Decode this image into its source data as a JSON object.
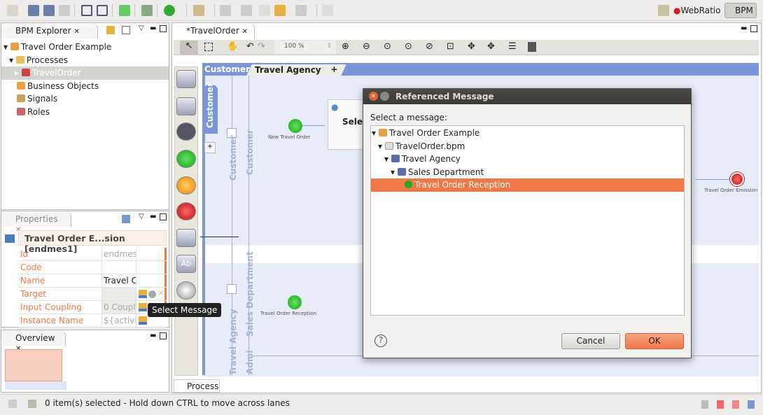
{
  "perspectives": {
    "webratio": "WebRatio",
    "bpm": "BPM"
  },
  "explorer": {
    "title": "BPM Explorer",
    "tree": [
      {
        "label": "Travel Order Example",
        "level": 0
      },
      {
        "label": "Processes",
        "level": 1
      },
      {
        "label": "TravelOrder",
        "level": 2,
        "selected": true
      },
      {
        "label": "Business Objects",
        "level": 1
      },
      {
        "label": "Signals",
        "level": 1
      },
      {
        "label": "Roles",
        "level": 1
      }
    ]
  },
  "properties": {
    "title": "Properties",
    "header": "Travel Order E...sion [endmes1]",
    "rows": [
      {
        "key": "Id",
        "value": "endmes1"
      },
      {
        "key": "Code",
        "value": ""
      },
      {
        "key": "Name",
        "value": "Travel Or"
      },
      {
        "key": "Target",
        "value": ""
      },
      {
        "key": "Input Coupling",
        "value": "0 Couple"
      },
      {
        "key": "Instance Name",
        "value": "${activity"
      }
    ],
    "tooltip": "Select Message"
  },
  "overview": {
    "title": "Overview"
  },
  "editor": {
    "tab": "*TravelOrder",
    "zoom": "100 %",
    "pool_tabs": [
      "Customer",
      "Travel Agency",
      "+"
    ],
    "lanes": {
      "customer_pool": "Customer",
      "customer_lane": "Customer",
      "customer_lane2": "Customer",
      "agency_pool": "Travel Agency",
      "sales": "Sales Department",
      "admin": "Admi"
    },
    "nodes": {
      "new_order": "New Travel Order",
      "task": "Selec",
      "emission": "Travel Order Emission",
      "reception": "Travel Order Reception"
    },
    "bottom_tab": "Process"
  },
  "dialog": {
    "title": "Referenced Message",
    "prompt": "Select a message:",
    "tree": [
      {
        "label": "Travel Order Example",
        "level": 0
      },
      {
        "label": "TravelOrder.bpm",
        "level": 1
      },
      {
        "label": "Travel Agency",
        "level": 2
      },
      {
        "label": "Sales Department",
        "level": 3
      },
      {
        "label": "Travel Order Reception",
        "level": 4,
        "selected": true
      }
    ],
    "cancel": "Cancel",
    "ok": "OK"
  },
  "status": {
    "text": "0 item(s) selected - Hold down CTRL to move across lanes"
  },
  "colors": {
    "accent": "#f07746",
    "pool_blue": "#7b96d8",
    "dialog_title": "#3c3b37"
  }
}
